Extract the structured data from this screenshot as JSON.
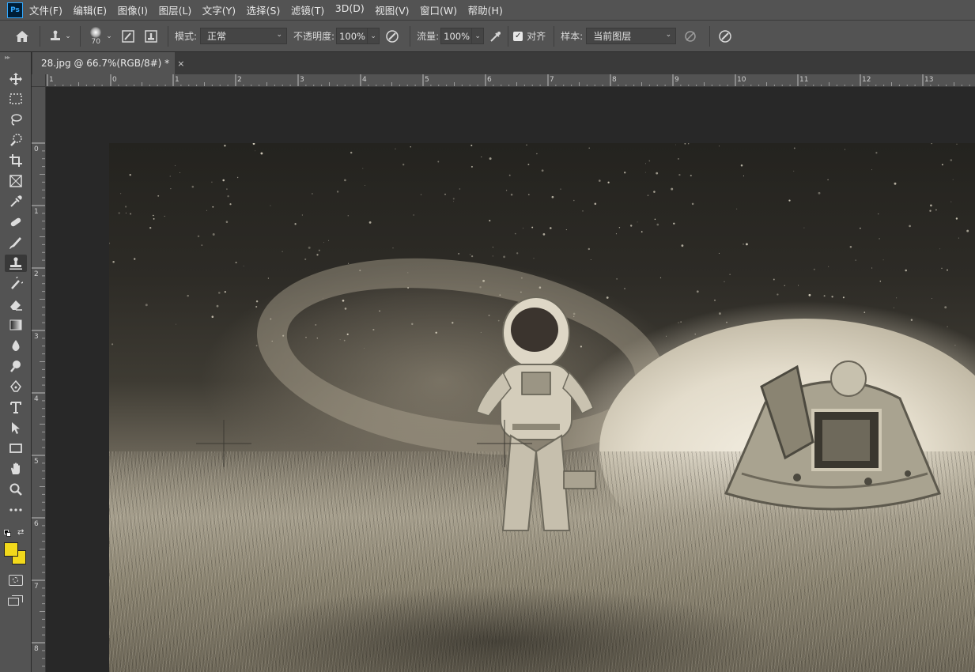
{
  "app": {
    "logo": "Ps"
  },
  "menu": [
    "文件(F)",
    "编辑(E)",
    "图像(I)",
    "图层(L)",
    "文字(Y)",
    "选择(S)",
    "滤镜(T)",
    "3D(D)",
    "视图(V)",
    "窗口(W)",
    "帮助(H)"
  ],
  "options": {
    "brush_size": "70",
    "mode_label": "模式:",
    "mode_value": "正常",
    "opacity_label": "不透明度:",
    "opacity_value": "100%",
    "flow_label": "流量:",
    "flow_value": "100%",
    "align_label": "对齐",
    "align_checked": true,
    "sample_label": "样本:",
    "sample_value": "当前图层"
  },
  "document": {
    "tab_title": "28.jpg @ 66.7%(RGB/8#) *",
    "close_glyph": "×"
  },
  "ruler": {
    "top_labels": [
      "1",
      "0",
      "1",
      "2",
      "3",
      "4",
      "5",
      "6",
      "7",
      "8",
      "9",
      "10",
      "11",
      "12",
      "13"
    ],
    "left_labels": [
      "0",
      "1",
      "2",
      "3",
      "4",
      "5",
      "6",
      "7",
      "8"
    ]
  },
  "toolbar": {
    "tools": [
      "move-tool-icon",
      "marquee-tool-icon",
      "lasso-tool-icon",
      "quick-select-tool-icon",
      "crop-tool-icon",
      "frame-tool-icon",
      "eyedropper-tool-icon",
      "healing-brush-tool-icon",
      "brush-tool-icon",
      "clone-stamp-tool-icon",
      "history-brush-tool-icon",
      "eraser-tool-icon",
      "gradient-tool-icon",
      "blur-tool-icon",
      "dodge-tool-icon",
      "pen-tool-icon",
      "type-tool-icon",
      "path-select-tool-icon",
      "rectangle-tool-icon",
      "hand-tool-icon",
      "zoom-tool-icon",
      "more-tools-icon"
    ],
    "active_tool": "clone-stamp-tool-icon",
    "foreground_color": "#f2d91b",
    "background_color": "#f2d91b"
  },
  "colors": {
    "accent": "#31a8ff",
    "panel": "#535353",
    "workspace": "#282828"
  }
}
